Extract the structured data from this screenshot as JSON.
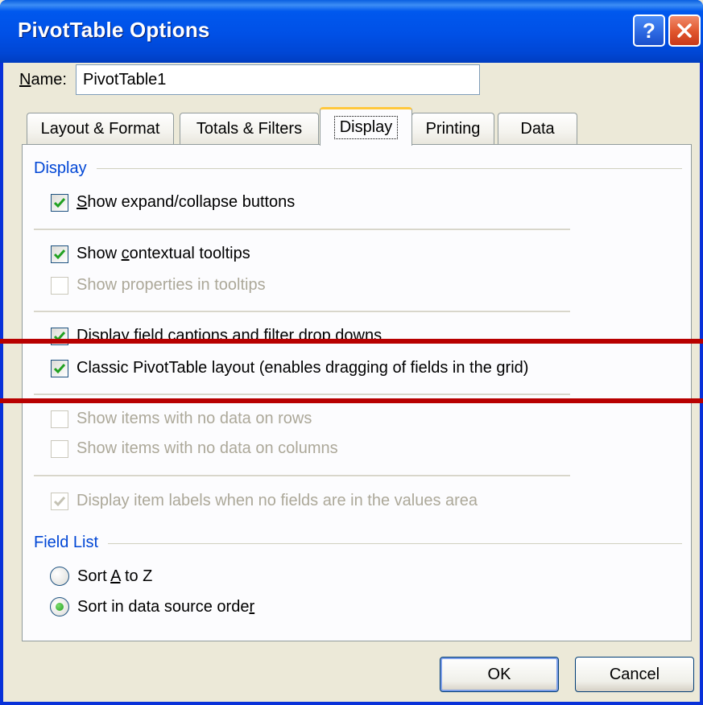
{
  "dialog": {
    "title": "PivotTable Options",
    "help_label": "?",
    "close_label": "✕"
  },
  "name": {
    "label_pre": "",
    "label_accel": "N",
    "label_post": "ame:",
    "value": "PivotTable1"
  },
  "tabs": [
    {
      "label": "Layout & Format",
      "active": false
    },
    {
      "label": "Totals & Filters",
      "active": false
    },
    {
      "label": "Display",
      "active": true
    },
    {
      "label": "Printing",
      "active": false
    },
    {
      "label": "Data",
      "active": false
    }
  ],
  "display_group": {
    "title": "Display",
    "items": [
      {
        "pre": "",
        "accel": "S",
        "post": "how expand/collapse buttons",
        "checked": true,
        "enabled": true
      },
      {
        "pre": "Show ",
        "accel": "c",
        "post": "ontextual tooltips",
        "checked": true,
        "enabled": true
      },
      {
        "pre": "Show properties in tooltips",
        "accel": "",
        "post": "",
        "checked": false,
        "enabled": false
      },
      {
        "pre": "Display field captions and filter drop downs",
        "accel": "",
        "post": "",
        "checked": true,
        "enabled": true
      },
      {
        "pre": "Classic PivotTable layout (enables dragging of fields in the grid)",
        "accel": "",
        "post": "",
        "checked": true,
        "enabled": true
      },
      {
        "pre": "Show items with no data on rows",
        "accel": "",
        "post": "",
        "checked": false,
        "enabled": false
      },
      {
        "pre": "Show items with no data on columns",
        "accel": "",
        "post": "",
        "checked": false,
        "enabled": false
      },
      {
        "pre": "Display item labels when no fields are in the values area",
        "accel": "",
        "post": "",
        "checked": true,
        "enabled": false
      }
    ]
  },
  "field_list_group": {
    "title": "Field List",
    "options": [
      {
        "pre": "Sort ",
        "accel": "A",
        "post": " to Z",
        "selected": false
      },
      {
        "pre": "Sort in data source orde",
        "accel": "r",
        "post": "",
        "selected": true
      }
    ]
  },
  "buttons": {
    "ok": "OK",
    "cancel": "Cancel"
  },
  "colors": {
    "group_title": "#0046D5",
    "annotation_line": "#B80000",
    "title_bar": "#0054E3"
  }
}
